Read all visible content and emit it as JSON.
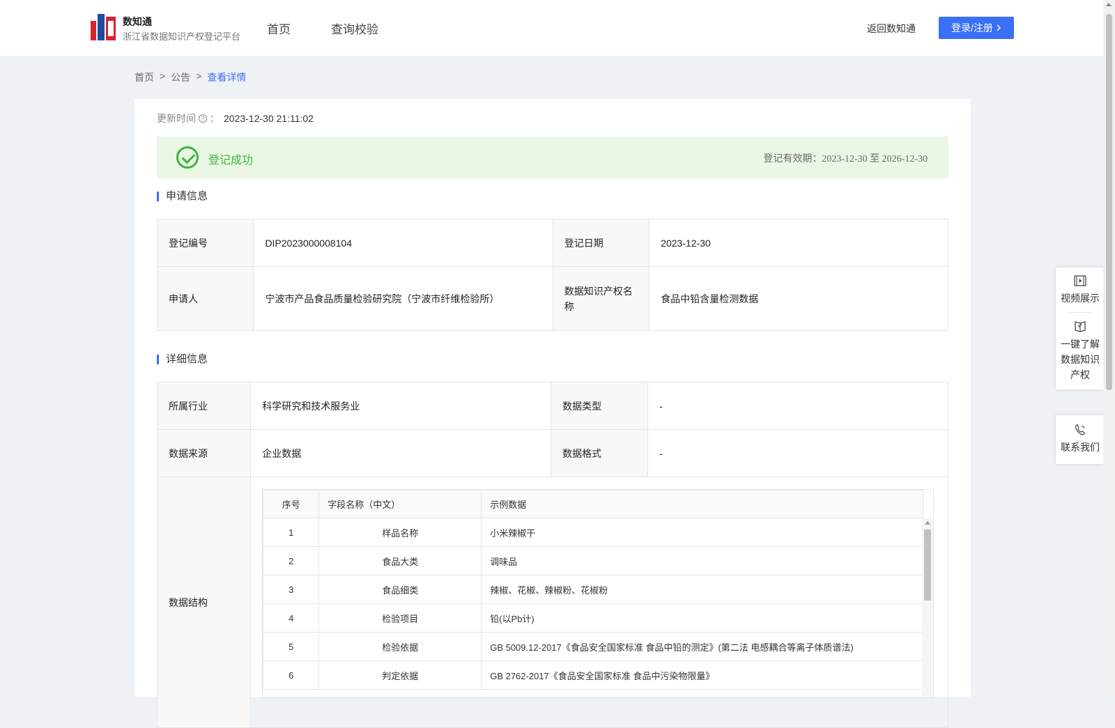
{
  "header": {
    "brand_name": "数知通",
    "brand_sub": "浙江省数据知识产权登记平台",
    "nav": [
      "首页",
      "查询校验"
    ],
    "back_link": "返回数知通",
    "login_button": "登录/注册"
  },
  "breadcrumb": {
    "home": "首页",
    "sep": ">",
    "notice": "公告",
    "current": "查看详情"
  },
  "update": {
    "label": "更新时间",
    "suffix": "：",
    "value": "2023-12-30 21:11:02"
  },
  "status": {
    "text": "登记成功",
    "validity_label": "登记有效期：",
    "validity_value": "2023-12-30 至 2026-12-30",
    "color": "#3fb43f"
  },
  "application": {
    "title": "申请信息",
    "reg_no_label": "登记编号",
    "reg_no": "DIP2023000008104",
    "reg_date_label": "登记日期",
    "reg_date": "2023-12-30",
    "applicant_label": "申请人",
    "applicant": "宁波市产品食品质量检验研究院（宁波市纤维检验所）",
    "ip_name_label": "数据知识产权名称",
    "ip_name": "食品中铅含量检测数据"
  },
  "details": {
    "title": "详细信息",
    "industry_label": "所属行业",
    "industry": "科学研究和技术服务业",
    "data_type_label": "数据类型",
    "data_type": "-",
    "source_label": "数据来源",
    "source": "企业数据",
    "format_label": "数据格式",
    "format": "-",
    "structure_label": "数据结构"
  },
  "fields_table": {
    "headers": [
      "序号",
      "字段名称（中文）",
      "示例数据"
    ],
    "rows": [
      [
        "1",
        "样品名称",
        "小米辣椒干"
      ],
      [
        "2",
        "食品大类",
        "调味品"
      ],
      [
        "3",
        "食品细类",
        "辣椒、花椒、辣椒粉、花椒粉"
      ],
      [
        "4",
        "检验项目",
        "铅(以Pb计)"
      ],
      [
        "5",
        "检验依据",
        "GB 5009.12-2017《食品安全国家标准 食品中铅的测定》(第二法 电感耦合等离子体质谱法)"
      ],
      [
        "6",
        "判定依据",
        "GB 2762-2017《食品安全国家标准 食品中污染物限量》"
      ]
    ]
  },
  "side_panel": {
    "video": "视频展示",
    "learn_1": "一键了解",
    "learn_2": "数据知识",
    "learn_3": "产权",
    "contact": "联系我们"
  },
  "accent_color": "#3a6ff7"
}
